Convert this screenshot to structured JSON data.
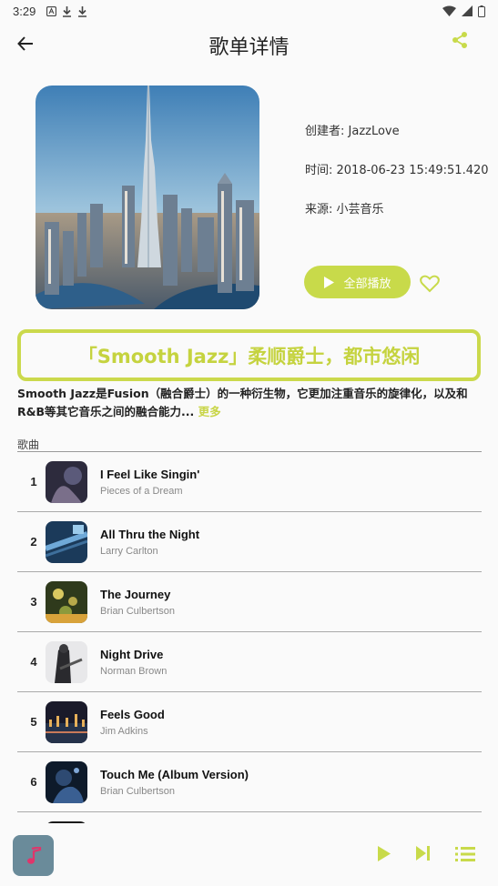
{
  "status_bar": {
    "time": "3:29"
  },
  "header": {
    "title": "歌单详情"
  },
  "playlist": {
    "creator_label": "创建者: JazzLove",
    "time_label": "时间: 2018-06-23 15:49:51.420",
    "source_label": "来源: 小芸音乐",
    "play_all_label": "全部播放",
    "banner_title": "「Smooth Jazz」柔顺爵士，都市悠闲",
    "description": "Smooth Jazz是Fusion（融合爵士）的一种衍生物，它更加注重音乐的旋律化，以及和R&B等其它音乐之间的融合能力...",
    "more_label": "更多"
  },
  "songs_header": "歌曲",
  "songs": [
    {
      "index": "1",
      "name": "I Feel Like Singin'",
      "artist": "Pieces of a Dream"
    },
    {
      "index": "2",
      "name": "All Thru the Night",
      "artist": "Larry Carlton"
    },
    {
      "index": "3",
      "name": "The Journey",
      "artist": "Brian Culbertson"
    },
    {
      "index": "4",
      "name": "Night Drive",
      "artist": "Norman Brown"
    },
    {
      "index": "5",
      "name": "Feels Good",
      "artist": "Jim Adkins"
    },
    {
      "index": "6",
      "name": "Touch Me (Album Version)",
      "artist": "Brian Culbertson"
    }
  ],
  "colors": {
    "accent": "#c8da4a",
    "mini_art": "#6a8b9a",
    "note": "#e0356b"
  },
  "icons": [
    "back-arrow-icon",
    "share-icon",
    "play-icon",
    "heart-icon",
    "music-note-icon",
    "next-icon",
    "playlist-icon"
  ]
}
